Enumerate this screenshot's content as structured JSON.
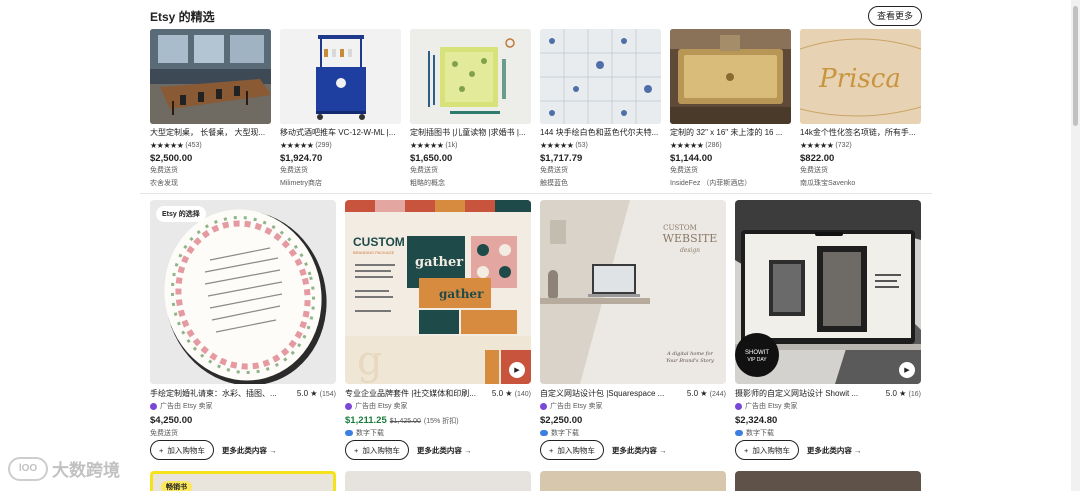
{
  "header": {
    "title": "Etsy 的精选",
    "see_more": "查看更多"
  },
  "picks": [
    {
      "title": "大型定制桌， 长餐桌， 大型现...",
      "stars": "★★★★★",
      "reviews": "(453)",
      "price": "$2,500.00",
      "shipping": "免费送货",
      "shop": "农舍发现"
    },
    {
      "title": "移动式酒吧推车 VC-12-W-ML |...",
      "stars": "★★★★★",
      "reviews": "(299)",
      "price": "$1,924.70",
      "shipping": "免费送货",
      "shop": "Milimetry商店"
    },
    {
      "title": "定制插图书 |儿童读物 |求婚书 |...",
      "stars": "★★★★★",
      "reviews": "(1k)",
      "price": "$1,650.00",
      "shipping": "免费送货",
      "shop": "粗略的概念"
    },
    {
      "title": "144 块手绘白色和蓝色代尔夫特...",
      "stars": "★★★★★",
      "reviews": "(53)",
      "price": "$1,717.79",
      "shipping": "免费送货",
      "shop": "触摸蓝色"
    },
    {
      "title": "定制的 32\" x 16\" 未上漆的 16 ...",
      "stars": "★★★★★",
      "reviews": "(286)",
      "price": "$1,144.00",
      "shipping": "免费送货",
      "shop": "InsideFez （内菲斯酒店）"
    },
    {
      "title": "14k金个性化签名项链，所有手...",
      "stars": "★★★★★",
      "reviews": "(732)",
      "price": "$822.00",
      "shipping": "免费送货",
      "shop": "南瓜珠宝Savenko"
    }
  ],
  "ads": [
    {
      "badge": "Etsy 的选择",
      "title": "手绘定制婚礼请柬：水彩、插图、...",
      "score": "5.0 ★",
      "count": "(154)",
      "seller": "广告由 Etsy 卖家",
      "price": "$4,250.00",
      "orig_price": "",
      "discount": "",
      "shipping": "免费送货",
      "cart": "加入购物车",
      "more": "更多此类内容 →"
    },
    {
      "badge": "",
      "title": "专业企业品牌套件 |社交媒体和印刷...",
      "score": "5.0 ★",
      "count": "(140)",
      "seller": "广告由 Etsy 卖家",
      "price": "$1,211.25",
      "orig_price": "$1,425.00",
      "discount": "(15% 折扣)",
      "shipping": "数字下载",
      "cart": "加入购物车",
      "more": "更多此类内容 →"
    },
    {
      "badge": "",
      "title": "自定义网站设计包 |Squarespace ...",
      "score": "5.0 ★",
      "count": "(244)",
      "seller": "广告由 Etsy 卖家",
      "price": "$2,250.00",
      "orig_price": "",
      "discount": "",
      "shipping": "数字下载",
      "cart": "加入购物车",
      "more": "更多此类内容 →"
    },
    {
      "badge": "",
      "title": "摄影师的自定义网站设计 Showit ...",
      "score": "5.0 ★",
      "count": "(16)",
      "seller": "广告由 Etsy 卖家",
      "price": "$2,324.80",
      "orig_price": "",
      "discount": "",
      "shipping": "数字下载",
      "cart": "加入购物车",
      "more": "更多此类内容 →"
    }
  ],
  "image_text": {
    "custom": "CUSTOM",
    "branding_package": "BRANDING PACKAGE",
    "gather": "gather",
    "custom_website": "CUSTOM",
    "website": "WEBSITE",
    "design": "design",
    "digital_home": "A digital home for",
    "your_brand": "Your Brand's Story",
    "showit": "SHOWIT",
    "vip_day": "VIP DAY",
    "priscca": "Prisca"
  },
  "bottom": {
    "bestseller": "畅销书"
  },
  "watermark": {
    "logo": "lOO",
    "text": "大数跨境"
  },
  "colors": {
    "accent_green": "#1a7d3b",
    "badge_yellow": "#fce85a",
    "seller_purple": "#7a47d6"
  }
}
